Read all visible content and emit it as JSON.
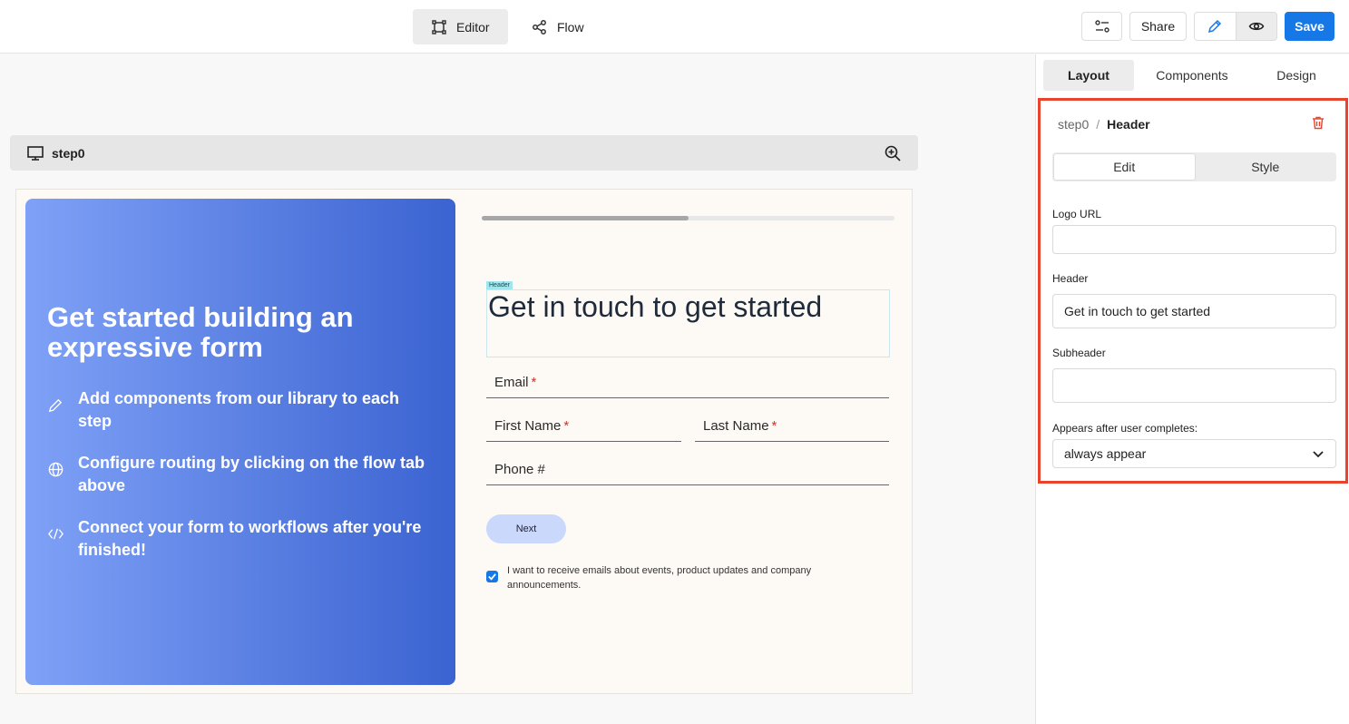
{
  "topbar": {
    "tabs": [
      {
        "label": "Editor",
        "icon": "editor-frame-icon",
        "active": true
      },
      {
        "label": "Flow",
        "icon": "flow-share-icon",
        "active": false
      }
    ],
    "settings_icon": "sliders-icon",
    "share_label": "Share",
    "edit_icon": "pencil-icon",
    "preview_icon": "eye-icon",
    "save_label": "Save",
    "accent_color": "#1677e6"
  },
  "canvas": {
    "step": {
      "name": "step0",
      "device_icon": "monitor-icon",
      "zoom_icon": "zoom-in-icon"
    },
    "hero": {
      "title": "Get started building an expressive form",
      "features": [
        {
          "icon": "pencil-icon",
          "text": "Add components from our library to each step"
        },
        {
          "icon": "globe-icon",
          "text": "Configure routing by clicking on the flow tab above"
        },
        {
          "icon": "code-icon",
          "text": "Connect your form to workflows after you're finished!"
        }
      ],
      "gradient_start": "#7fa1f7",
      "gradient_end": "#3b63d1"
    },
    "progress": 0.5,
    "header_tag": "Header",
    "header_text": "Get in touch to get started",
    "fields": {
      "email": {
        "label": "Email",
        "required": "*"
      },
      "first_name": {
        "label": "First Name",
        "required": "*"
      },
      "last_name": {
        "label": "Last Name",
        "required": "*"
      },
      "phone": {
        "label": "Phone #"
      }
    },
    "next_label": "Next",
    "consent_text": "I want to receive emails about events, product updates and company announcements.",
    "consent_checked": true
  },
  "panel": {
    "tabs": [
      {
        "label": "Layout",
        "active": true
      },
      {
        "label": "Components",
        "active": false
      },
      {
        "label": "Design",
        "active": false
      }
    ],
    "breadcrumb": {
      "parent": "step0",
      "separator": "/",
      "current": "Header"
    },
    "delete_icon": "trash-icon",
    "subtabs": [
      {
        "label": "Edit",
        "active": true
      },
      {
        "label": "Style",
        "active": false
      }
    ],
    "logo_url": {
      "label": "Logo URL",
      "value": ""
    },
    "header": {
      "label": "Header",
      "value": "Get in touch to get started"
    },
    "subheader": {
      "label": "Subheader",
      "value": ""
    },
    "appears_after": {
      "label": "Appears after user completes:",
      "value": "always appear"
    },
    "highlight_color": "#e8432c"
  }
}
